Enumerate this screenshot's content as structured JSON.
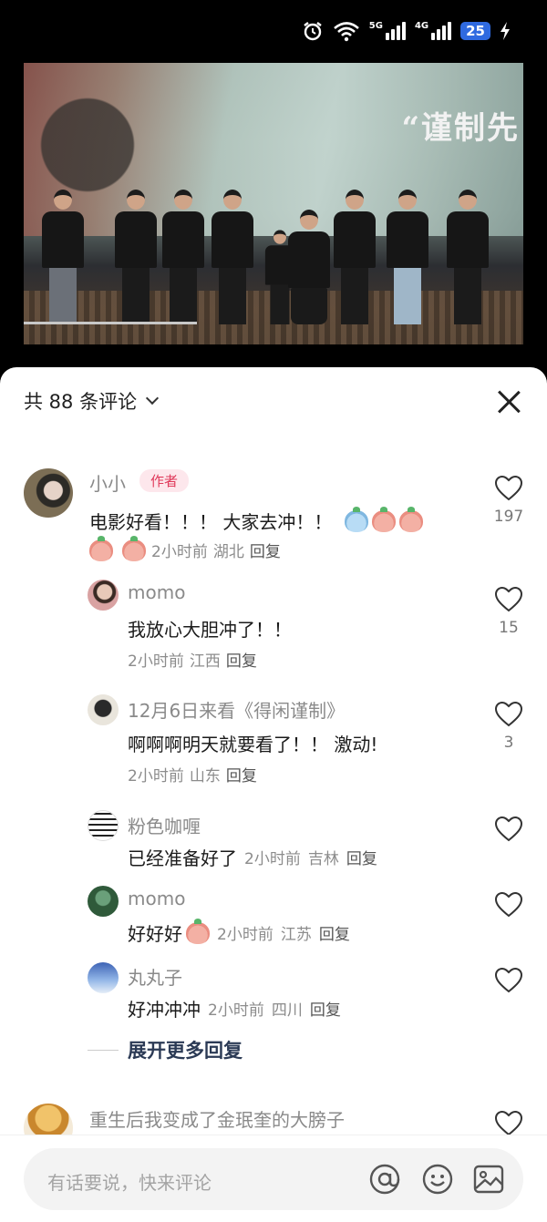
{
  "status_bar": {
    "network_5g": "5G",
    "network_4g": "4G",
    "battery": "25"
  },
  "video": {
    "caption": "“谨制先"
  },
  "sheet": {
    "title": "共 88 条评论"
  },
  "comments": [
    {
      "user": "小小",
      "badge": "作者",
      "text": "电影好看！！！ 大家去冲！！",
      "time": "2小时前",
      "location": "湖北",
      "reply": "回复",
      "likes": "197"
    }
  ],
  "replies": [
    {
      "user": "momo",
      "text": "我放心大胆冲了！！",
      "time": "2小时前",
      "location": "江西",
      "reply": "回复",
      "likes": "15"
    },
    {
      "user": "12月6日来看《得闲谨制》",
      "text": "啊啊啊明天就要看了！！ 激动!",
      "time": "2小时前",
      "location": "山东",
      "reply": "回复",
      "likes": "3"
    },
    {
      "user": "粉色咖喱",
      "text": "已经准备好了",
      "time": "2小时前",
      "location": "吉林",
      "reply": "回复",
      "likes": ""
    },
    {
      "user": "momo",
      "text": "好好好",
      "time": "2小时前",
      "location": "江苏",
      "reply": "回复",
      "likes": ""
    },
    {
      "user": "丸丸子",
      "text": "好冲冲冲",
      "time": "2小时前",
      "location": "四川",
      "reply": "回复",
      "likes": ""
    }
  ],
  "expand_more": "展开更多回复",
  "next_comment": {
    "user": "重生后我变成了金珉奎的大膀子"
  },
  "input": {
    "placeholder": "有话要说，快来评论"
  },
  "icons": {
    "alarm": "alarm-icon",
    "wifi": "wifi-icon",
    "charging": "charging-icon",
    "close": "close-icon",
    "like": "heart-icon",
    "mention": "at-icon",
    "emoji": "emoji-icon",
    "image": "image-icon"
  },
  "colors": {
    "author_badge": "#e0395a",
    "battery": "#2f6ae0",
    "expand_text": "#2b3a55"
  }
}
